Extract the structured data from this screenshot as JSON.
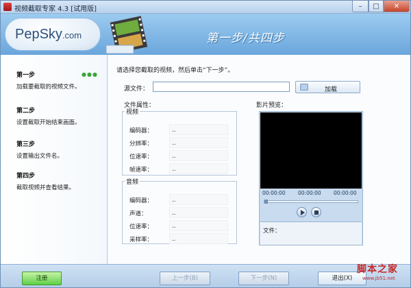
{
  "window": {
    "title": "视频截取专家 4.3 [试用版]",
    "controls": {
      "minimize": "–",
      "maximize": "□",
      "close": "✕"
    }
  },
  "header": {
    "logo": "PepSky",
    "logo_suffix": ".com",
    "step_title": "第一步/共四步"
  },
  "sidebar": {
    "steps": [
      {
        "title": "第一步",
        "desc": "加载要截取的视频文件。",
        "active": true
      },
      {
        "title": "第二步",
        "desc": "设置截取开始结束画面。"
      },
      {
        "title": "第三步",
        "desc": "设置输出文件名。"
      },
      {
        "title": "第四步",
        "desc": "截取视频并查看结果。"
      }
    ],
    "active_indicator": "●●●"
  },
  "main": {
    "instruction": "请选择您截取的视频，然后单击“下一步”。",
    "source_label": "源文件：",
    "source_value": "",
    "load_button": "加载",
    "attributes_label": "文件属性：",
    "preview_label": "影片预览：",
    "video_group": {
      "legend": "视频",
      "rows": [
        {
          "key": "编码器：",
          "value": ".."
        },
        {
          "key": "分辨率：",
          "value": ".."
        },
        {
          "key": "位速率：",
          "value": ".."
        },
        {
          "key": "帧速率：",
          "value": ".."
        }
      ]
    },
    "audio_group": {
      "legend": "音频",
      "rows": [
        {
          "key": "编码器：",
          "value": ".."
        },
        {
          "key": "声道：",
          "value": ".."
        },
        {
          "key": "位速率：",
          "value": ".."
        },
        {
          "key": "采样率：",
          "value": ".."
        }
      ]
    },
    "player": {
      "time_start": "00:00:00",
      "time_mid": "00:00:00",
      "time_end": "00:00:00",
      "file_label": "文件："
    }
  },
  "footer": {
    "register": "注册",
    "prev": "上一步(B)",
    "next": "下一步(N)",
    "exit": "退出(X)"
  },
  "watermark": {
    "text": "脚本之家",
    "url": "www.jb51.net"
  },
  "colors": {
    "header": "#7ab3e3",
    "accent": "#5fd046",
    "watermark": "#c42a2a"
  }
}
